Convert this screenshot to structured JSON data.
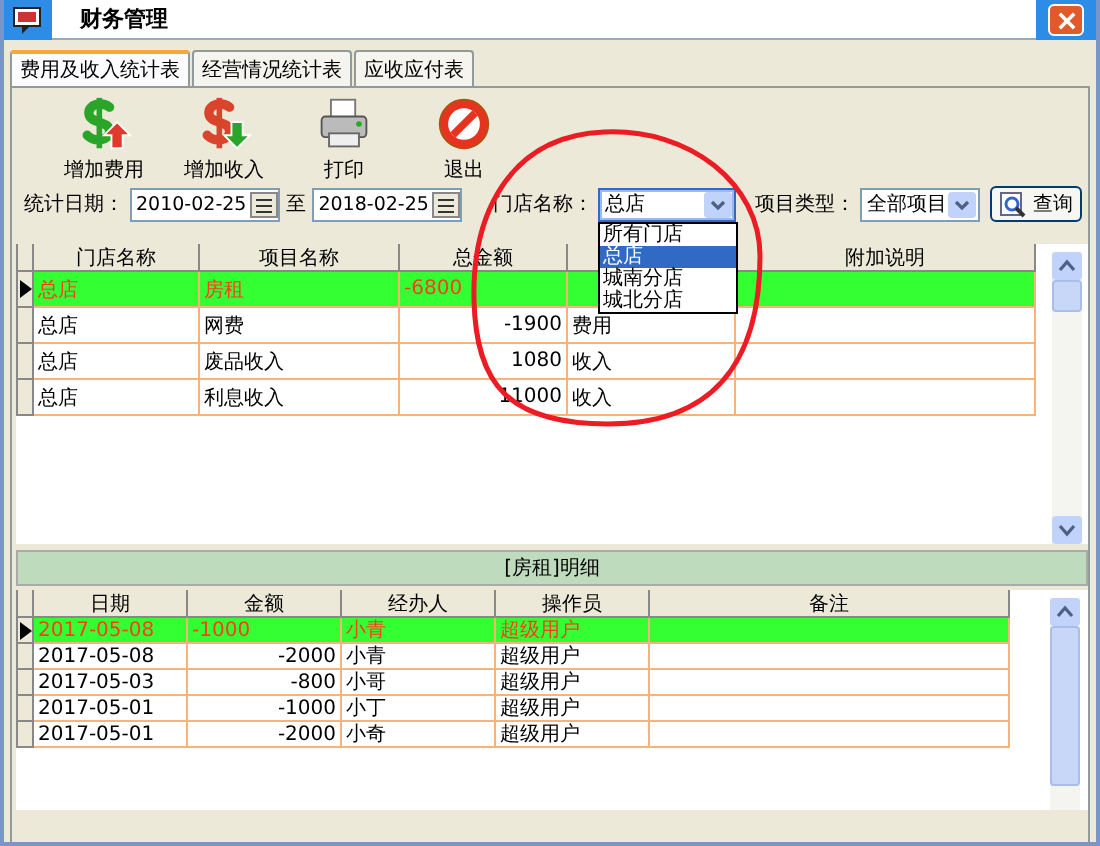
{
  "window": {
    "title": "财务管理"
  },
  "tabs": [
    {
      "label": "费用及收入统计表",
      "selected": true
    },
    {
      "label": "经营情况统计表",
      "selected": false
    },
    {
      "label": "应收应付表",
      "selected": false
    }
  ],
  "toolbar": [
    {
      "label": "增加费用",
      "kind": "add-expense"
    },
    {
      "label": "增加收入",
      "kind": "add-income"
    },
    {
      "label": "打印",
      "kind": "print"
    },
    {
      "label": "退出",
      "kind": "exit"
    }
  ],
  "filters": {
    "date_label": "统计日期：",
    "date_from": "2010-02-25",
    "to_label": "至",
    "date_to": "2018-02-25",
    "store_label": "门店名称：",
    "store_value": "总店",
    "type_label": "项目类型：",
    "type_value": "全部项目",
    "query_button": "查询"
  },
  "store_dropdown": {
    "expanded": true,
    "options": [
      {
        "label": "所有门店",
        "selected": false
      },
      {
        "label": "总店",
        "selected": true
      },
      {
        "label": "城南分店",
        "selected": false
      },
      {
        "label": "城北分店",
        "selected": false
      }
    ]
  },
  "summary_table": {
    "header": {
      "store": "门店名称",
      "item": "项目名称",
      "amount": "总金额",
      "note": "附加说明"
    },
    "rows": [
      {
        "selected": true,
        "store": "总店",
        "item": "房租",
        "amount": "-6800"
      },
      {
        "selected": false,
        "store": "总店",
        "item": "网费",
        "amount": "-1900",
        "type": "费用"
      },
      {
        "selected": false,
        "store": "总店",
        "item": "废品收入",
        "amount": "1080",
        "type": "收入"
      },
      {
        "selected": false,
        "store": "总店",
        "item": "利息收入",
        "amount": "11000",
        "type": "收入"
      }
    ]
  },
  "detail_title": "[房租]明细",
  "detail_table": {
    "columns": [
      "日期",
      "金额",
      "经办人",
      "操作员",
      "备注"
    ],
    "rows": [
      {
        "selected": true,
        "date": "2017-05-08",
        "amount": "-1000",
        "handler": "小青",
        "operator": "超级用户"
      },
      {
        "selected": false,
        "date": "2017-05-08",
        "amount": "-2000",
        "handler": "小青",
        "operator": "超级用户"
      },
      {
        "selected": false,
        "date": "2017-05-03",
        "amount": "-800",
        "handler": "小哥",
        "operator": "超级用户"
      },
      {
        "selected": false,
        "date": "2017-05-01",
        "amount": "-1000",
        "handler": "小丁",
        "operator": "超级用户"
      },
      {
        "selected": false,
        "date": "2017-05-01",
        "amount": "-2000",
        "handler": "小奇",
        "operator": "超级用户"
      }
    ]
  },
  "annotation": {
    "kind": "circle"
  }
}
